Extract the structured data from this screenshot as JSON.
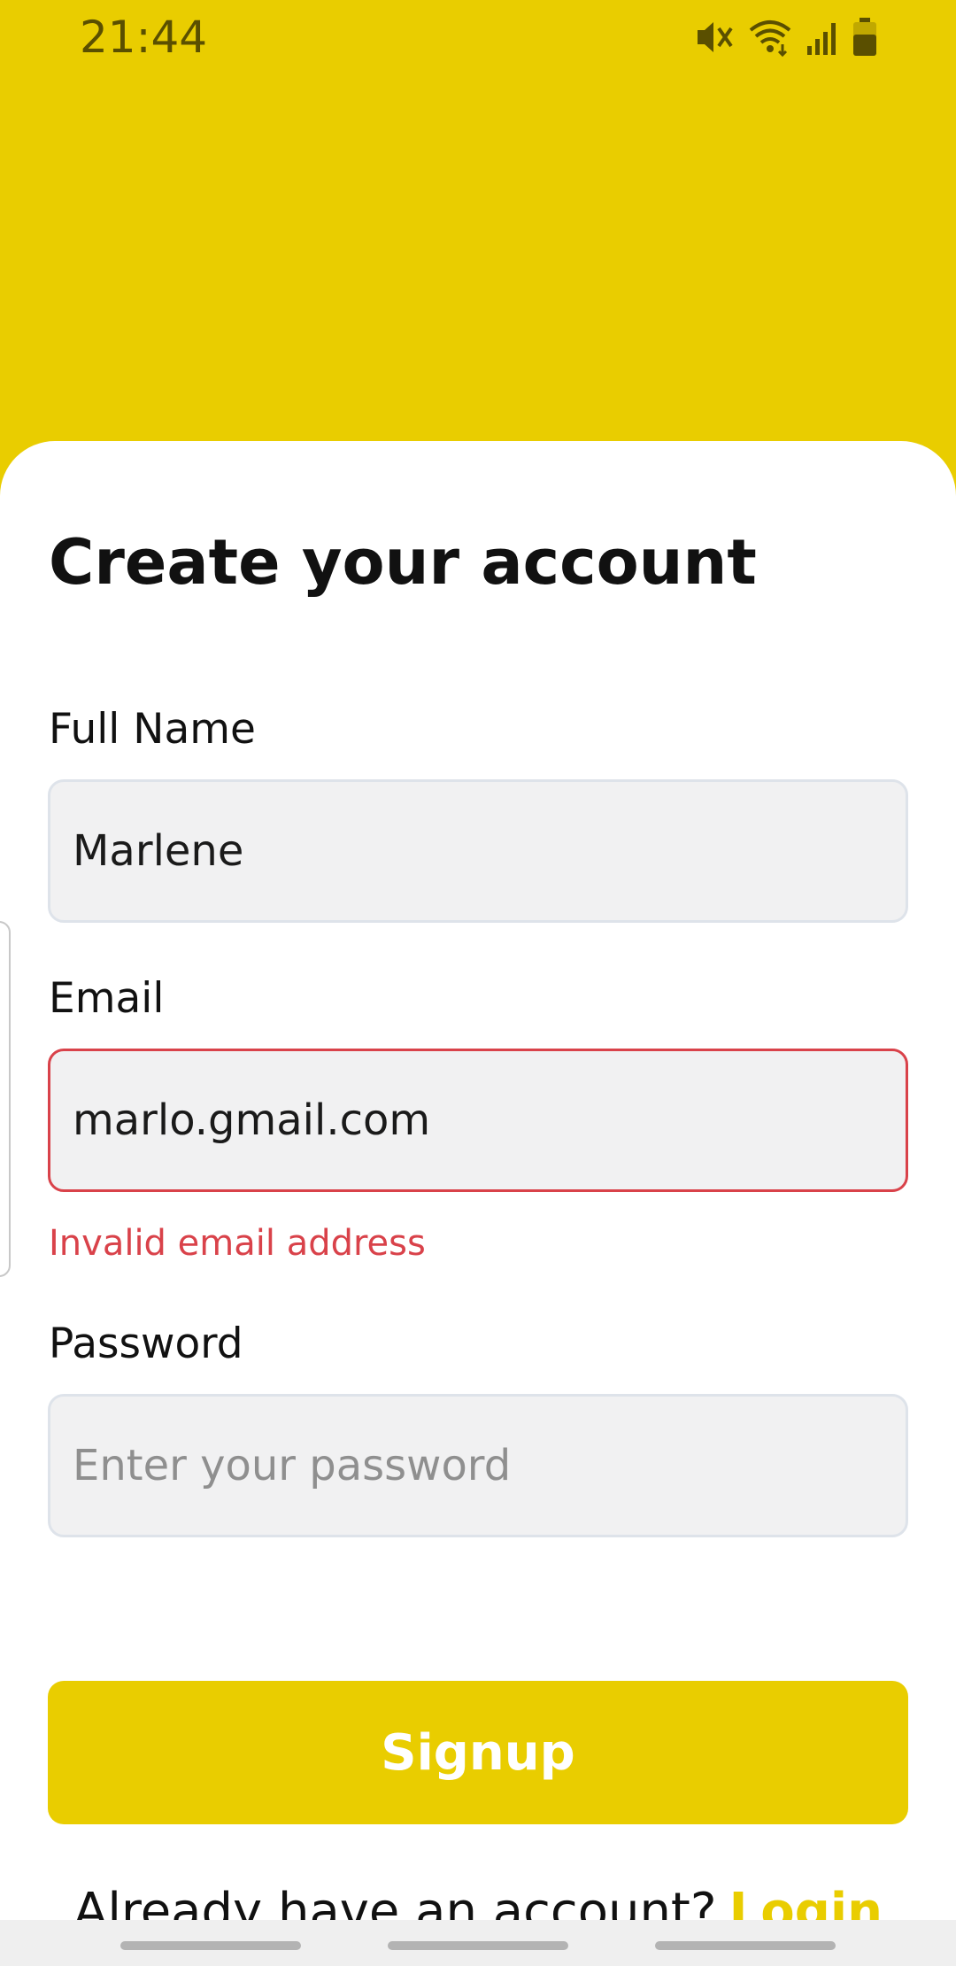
{
  "status_bar": {
    "time": "21:44",
    "icons": [
      "mute-icon",
      "wifi-icon",
      "signal-icon",
      "battery-icon"
    ]
  },
  "form": {
    "title": "Create your account",
    "full_name": {
      "label": "Full Name",
      "value": "Marlene",
      "placeholder": ""
    },
    "email": {
      "label": "Email",
      "value": "marlo.gmail.com",
      "placeholder": "",
      "error": "Invalid email address"
    },
    "password": {
      "label": "Password",
      "value": "",
      "placeholder": "Enter your password"
    },
    "submit_label": "Signup",
    "login_prompt": "Already have an account?",
    "login_link": "Login"
  },
  "colors": {
    "accent": "#E9CD00",
    "error": "#D9424A",
    "input_background": "#F1F1F2"
  }
}
